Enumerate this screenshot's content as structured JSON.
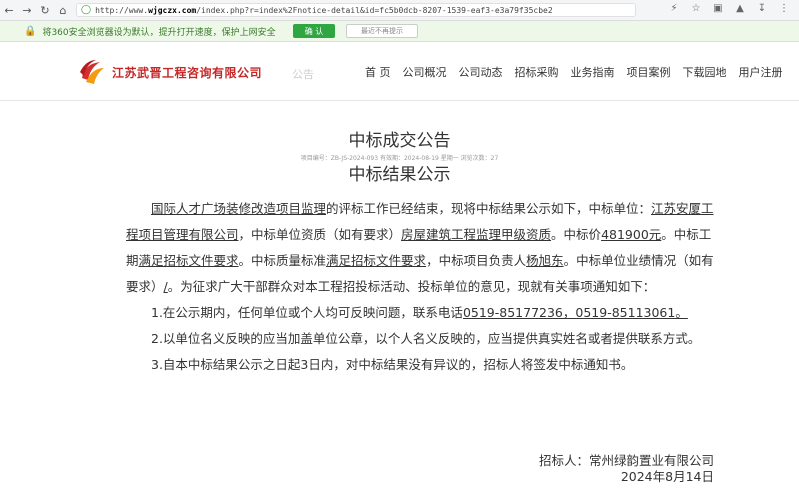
{
  "browser": {
    "url_prefix": "http://www.",
    "url_domain": "wjgczx.com",
    "url_path": "/index.php?r=index%2Fnotice-detail&id=fc5b0dcb-8207-1539-eaf3-e3a79f35cbe2"
  },
  "notice_bar": {
    "message": "将360安全浏览器设为默认，提升打开速度，保护上网安全",
    "confirm_label": "确 认",
    "dismiss_label": "最近不再提示"
  },
  "header": {
    "company_name": "江苏武晋工程咨询有限公司",
    "faded_word": "公告",
    "nav": [
      "首 页",
      "公司概况",
      "公司动态",
      "招标采购",
      "业务指南",
      "项目案例",
      "下载园地",
      "用户注册"
    ]
  },
  "article": {
    "title": "中标成交公告",
    "meta": "项目编号：ZB-JS-2024-093  有效期：2024-08-19 星期一  浏览次数：27",
    "sub_title": "中标结果公示",
    "p1": {
      "project": "国际人才广场装修改造项目监理",
      "t1": "的评标工作已经结束，现将中标结果公示如下，中标单位：",
      "winner": "江苏安厦工程项目管理有限公司",
      "t2": "，中标单位资质（如有要求）",
      "qualification": "房屋建筑工程监理甲级资质",
      "t3": "。中标价",
      "price": "481900元",
      "t4": "。中标工期",
      "period": "满足招标文件要求",
      "t5": "。中标质量标准",
      "quality": "满足招标文件要求",
      "t6": "，中标项目负责人",
      "manager": "杨旭东",
      "t7": "。中标单位业绩情况（如有要求）",
      "performance": "/",
      "t8": "。为征求广大干部群众对本工程招投标活动、投标单位的意见，现就有关事项通知如下："
    },
    "p2_text": "1.在公示期内，任何单位或个人均可反映问题，联系电话",
    "p2_phone": "0519-85177236，0519-85113061。",
    "p3": "2.以单位名义反映的应当加盖单位公章，以个人名义反映的，应当提供真实姓名或者提供联系方式。",
    "p4": "3.自本中标结果公示之日起3日内，对中标结果没有异议的，招标人将签发中标通知书。",
    "signer": "招标人：常州绿韵置业有限公司",
    "date": "2024年8月14日"
  }
}
